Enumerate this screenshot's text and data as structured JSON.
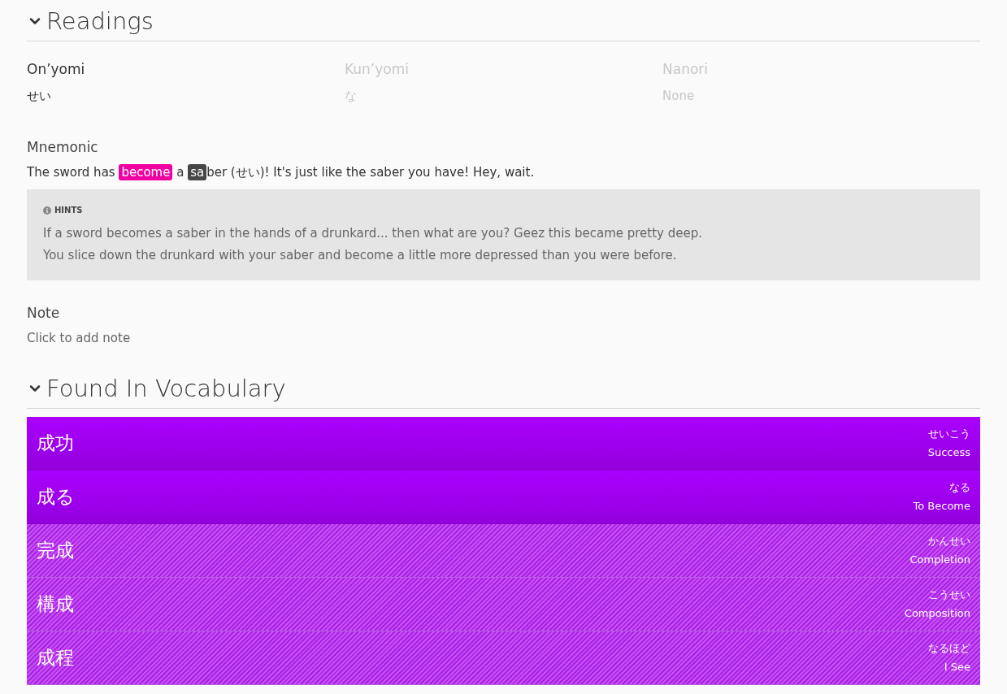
{
  "readings_section": {
    "title": "Readings",
    "expanded": true,
    "readings": [
      {
        "label": "On’yomi",
        "value": "せい",
        "primary": true
      },
      {
        "label": "Kun’yomi",
        "value": "な",
        "primary": false
      },
      {
        "label": "Nanori",
        "value": "None",
        "primary": false
      }
    ],
    "mnemonic": {
      "label": "Mnemonic",
      "parts": [
        {
          "kind": "text",
          "text": "The sword has "
        },
        {
          "kind": "kanji",
          "text": "become"
        },
        {
          "kind": "text",
          "text": " a "
        },
        {
          "kind": "reading",
          "text": "sa"
        },
        {
          "kind": "text",
          "text": "ber (せい)! It's just like the saber you have! Hey, wait."
        }
      ]
    },
    "hints": {
      "title": "HINTS",
      "lines": [
        "If a sword becomes a saber in the hands of a drunkard... then what are you? Geez this became pretty deep.",
        "You slice down the drunkard with your saber and become a little more depressed than you were before."
      ]
    },
    "note": {
      "label": "Note",
      "placeholder": "Click to add note"
    }
  },
  "vocabulary_section": {
    "title": "Found In Vocabulary",
    "expanded": true,
    "items": [
      {
        "word": "成功",
        "reading": "せいこう",
        "meaning": "Success",
        "learned": true
      },
      {
        "word": "成る",
        "reading": "なる",
        "meaning": "To Become",
        "learned": true
      },
      {
        "word": "完成",
        "reading": "かんせい",
        "meaning": "Completion",
        "learned": false
      },
      {
        "word": "構成",
        "reading": "こうせい",
        "meaning": "Composition",
        "learned": false
      },
      {
        "word": "成程",
        "reading": "なるほど",
        "meaning": "I See",
        "learned": false
      }
    ]
  }
}
